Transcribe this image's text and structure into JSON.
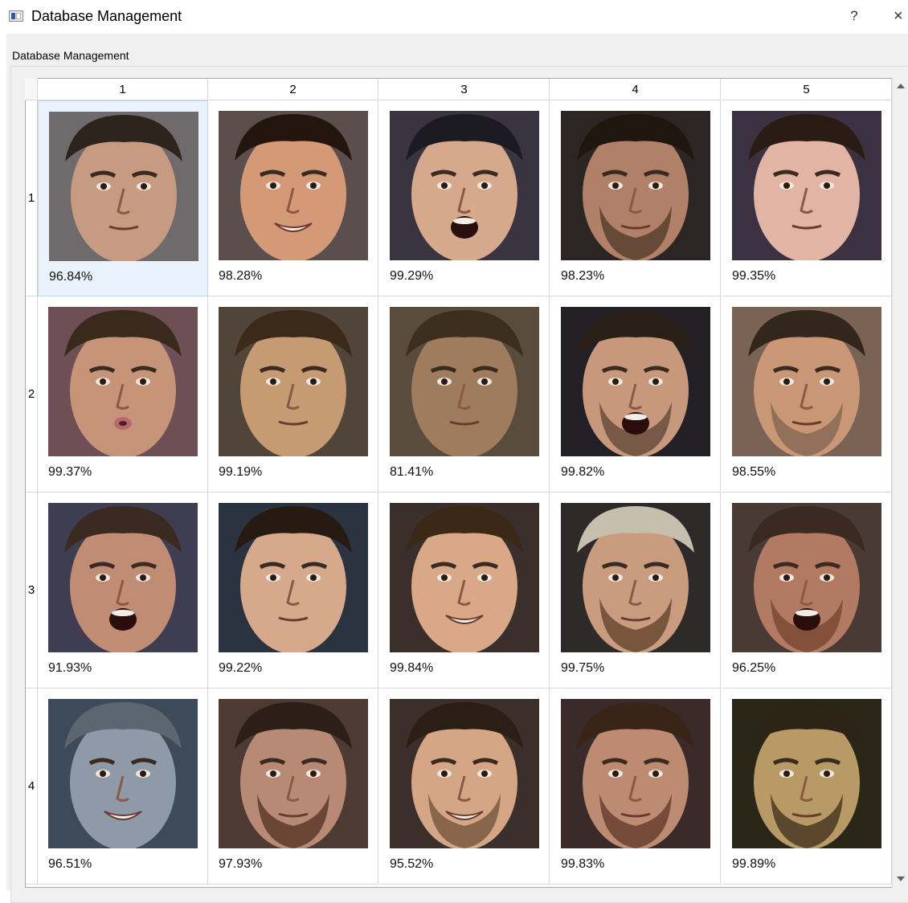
{
  "window": {
    "title": "Database Management",
    "help_label": "?",
    "close_label": "×"
  },
  "group": {
    "label": "Database Management"
  },
  "table": {
    "columns": [
      "1",
      "2",
      "3",
      "4",
      "5"
    ],
    "rows": [
      {
        "label": "1",
        "scores": [
          "96.84%",
          "98.28%",
          "99.29%",
          "98.23%",
          "99.35%"
        ]
      },
      {
        "label": "2",
        "scores": [
          "99.37%",
          "99.19%",
          "81.41%",
          "99.82%",
          "98.55%"
        ]
      },
      {
        "label": "3",
        "scores": [
          "91.93%",
          "99.22%",
          "99.84%",
          "99.75%",
          "96.25%"
        ]
      },
      {
        "label": "4",
        "scores": [
          "96.51%",
          "97.93%",
          "95.52%",
          "99.83%",
          "99.89%"
        ]
      }
    ],
    "selected_cell": "1-1"
  },
  "faces": [
    {
      "skin": "#c79a82",
      "hair": "#2d241e",
      "bg": "#6f6b6d",
      "beard": "",
      "mouth": "neutral"
    },
    {
      "skin": "#d49a78",
      "hair": "#24160f",
      "bg": "#5a4f4c",
      "beard": "",
      "mouth": "smile"
    },
    {
      "skin": "#d6a88c",
      "hair": "#1c1a22",
      "bg": "#3a3440",
      "beard": "",
      "mouth": "open"
    },
    {
      "skin": "#b08068",
      "hair": "#1f1610",
      "bg": "#2b2524",
      "beard": "#5a3f30",
      "mouth": "neutral"
    },
    {
      "skin": "#e2b4a4",
      "hair": "#2a1c15",
      "bg": "#3b3140",
      "beard": "",
      "mouth": "neutral"
    },
    {
      "skin": "#c69478",
      "hair": "#3a2a1d",
      "bg": "#6e4f55",
      "beard": "",
      "mouth": "pout"
    },
    {
      "skin": "#c69a72",
      "hair": "#3b2a1a",
      "bg": "#51453a",
      "beard": "",
      "mouth": "neutral"
    },
    {
      "skin": "#a07c5e",
      "hair": "#3b2d20",
      "bg": "#5a4c3c",
      "beard": "",
      "mouth": "neutral"
    },
    {
      "skin": "#c8987c",
      "hair": "#2a1f18",
      "bg": "#222024",
      "beard": "#6a4e3e",
      "mouth": "open"
    },
    {
      "skin": "#c99676",
      "hair": "#33261c",
      "bg": "#7a6255",
      "beard": "#8a6a55",
      "mouth": "neutral"
    },
    {
      "skin": "#c08c74",
      "hair": "#3a2a22",
      "bg": "#3e3d52",
      "beard": "",
      "mouth": "open"
    },
    {
      "skin": "#d6a88c",
      "hair": "#261a12",
      "bg": "#2c3340",
      "beard": "",
      "mouth": "neutral"
    },
    {
      "skin": "#d8a888",
      "hair": "#3b2817",
      "bg": "#3a2f2a",
      "beard": "",
      "mouth": "smile"
    },
    {
      "skin": "#c99c80",
      "hair": "#c7bfae",
      "bg": "#2f2a2a",
      "beard": "#6a4a32",
      "mouth": "neutral"
    },
    {
      "skin": "#b27a62",
      "hair": "#3a2a22",
      "bg": "#4a3a36",
      "beard": "#7a4a34",
      "mouth": "open"
    },
    {
      "skin": "#8f9aa8",
      "hair": "#5c6670",
      "bg": "#3d4a5a",
      "beard": "",
      "mouth": "smile"
    },
    {
      "skin": "#b88a76",
      "hair": "#2c1f18",
      "bg": "#4c3a33",
      "beard": "#5a3a2c",
      "mouth": "neutral"
    },
    {
      "skin": "#d4a686",
      "hair": "#2b1e15",
      "bg": "#3a2f2a",
      "beard": "#7a5a42",
      "mouth": "smile"
    },
    {
      "skin": "#bd8a72",
      "hair": "#3a2418",
      "bg": "#3a2a2a",
      "beard": "#6a4030",
      "mouth": "neutral"
    },
    {
      "skin": "#b89a66",
      "hair": "#2c2416",
      "bg": "#2a2618",
      "beard": "#4a3a22",
      "mouth": "neutral"
    }
  ]
}
